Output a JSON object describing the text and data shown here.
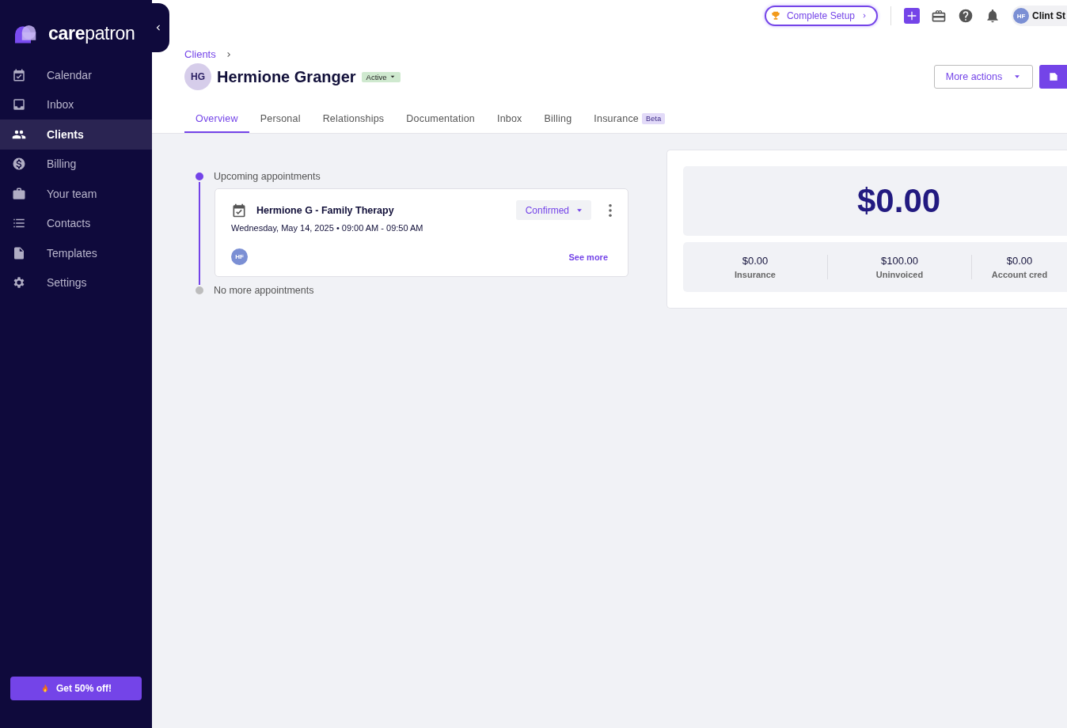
{
  "sidebar": {
    "logo": "**care**patron",
    "items": [
      {
        "label": "Calendar",
        "kind": "calendar",
        "selected": false
      },
      {
        "label": "Inbox",
        "kind": "inbox",
        "selected": false
      },
      {
        "label": "Clients",
        "kind": "people",
        "selected": true
      },
      {
        "label": "Billing",
        "kind": "dollar",
        "selected": false
      },
      {
        "label": "Your team",
        "kind": "briefcase",
        "selected": false
      },
      {
        "label": "Contacts",
        "kind": "list",
        "selected": false
      },
      {
        "label": "Templates",
        "kind": "document",
        "selected": false
      },
      {
        "label": "Settings",
        "kind": "gear",
        "selected": false
      }
    ],
    "promo_button": "Get 50% off!"
  },
  "topbar": {
    "setup_button": "Complete Setup",
    "user": {
      "initials": "HF",
      "name": "Clint St"
    }
  },
  "client": {
    "breadcrumb": "Clients",
    "initials": "HG",
    "name": "Hermione Granger",
    "status": "Active",
    "more_actions": "More actions"
  },
  "tabs": [
    {
      "label": "Overview",
      "selected": true
    },
    {
      "label": "Personal",
      "selected": false
    },
    {
      "label": "Relationships",
      "selected": false
    },
    {
      "label": "Documentation",
      "selected": false
    },
    {
      "label": "Inbox",
      "selected": false
    },
    {
      "label": "Billing",
      "selected": false
    },
    {
      "label": "Insurance",
      "badge": "Beta",
      "selected": false
    }
  ],
  "timeline": [
    {
      "kind": "upcoming",
      "label": "Upcoming appointments",
      "appointments": [
        {
          "title": "Hermione G - Family Therapy",
          "datetime": "Wednesday, May 14, 2025 • 09:00 AM - 09:50 AM",
          "status": "Confirmed",
          "attendee": "HF",
          "link": "See more"
        }
      ]
    },
    {
      "kind": "empty",
      "label": "No more appointments"
    }
  ],
  "balance": {
    "total": "$0.00",
    "breakdown": [
      {
        "amount": "$0.00",
        "label": "Insurance"
      },
      {
        "amount": "$100.00",
        "label": "Uninvoiced"
      },
      {
        "amount": "$0.00",
        "label": "Account cred"
      }
    ]
  }
}
